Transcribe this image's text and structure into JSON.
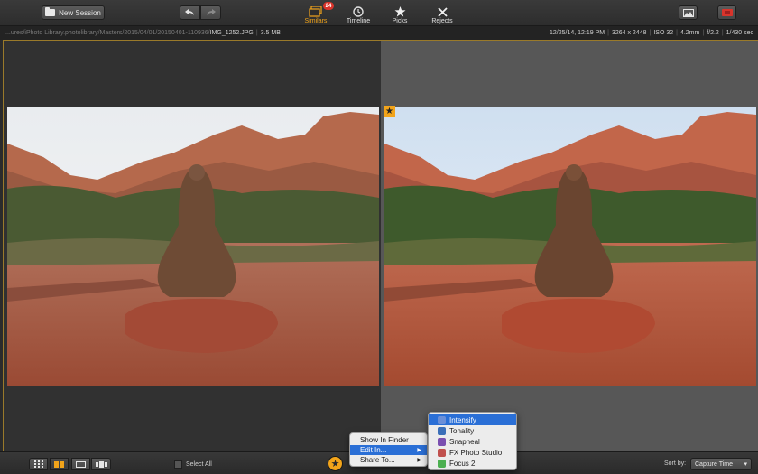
{
  "toolbar": {
    "new_session_label": "New Session",
    "undo_icon": "undo-arrow-icon",
    "redo_icon": "redo-arrow-icon",
    "tabs": [
      {
        "label": "Similars",
        "icon": "stack-icon",
        "badge": "24",
        "active": true
      },
      {
        "label": "Timeline",
        "icon": "clock-icon"
      },
      {
        "label": "Picks",
        "icon": "star-icon"
      },
      {
        "label": "Rejects",
        "icon": "x-icon"
      }
    ],
    "accent_color": "#f2a41a"
  },
  "infobar": {
    "path_dim": "...ures/iPhoto Library.photolibrary/Masters/2015/04/01/20150401-110936/",
    "file_name": "IMG_1252.JPG",
    "file_size": "3.5 MB",
    "date": "12/25/14, 12:19 PM",
    "dimensions": "3264 x 2448",
    "iso": "ISO 32",
    "focal": "4.2mm",
    "aperture": "f/2.2",
    "shutter": "1/430 sec"
  },
  "bottombar": {
    "select_all_label": "Select All",
    "sort_by_label": "Sort by:",
    "sort_value": "Capture Time"
  },
  "context_menu": {
    "items": [
      {
        "label": "Show In Finder",
        "has_submenu": false
      },
      {
        "label": "Edit In...",
        "has_submenu": true,
        "highlighted": true
      },
      {
        "label": "Share To...",
        "has_submenu": true
      }
    ]
  },
  "submenu": {
    "items": [
      {
        "label": "Intensify",
        "color": "#6a8fd8",
        "highlighted": true
      },
      {
        "label": "Tonality",
        "color": "#3b6fb8"
      },
      {
        "label": "Snapheal",
        "color": "#7a4fb0"
      },
      {
        "label": "FX Photo Studio",
        "color": "#c0504d"
      },
      {
        "label": "Focus 2",
        "color": "#4caf50"
      }
    ]
  }
}
